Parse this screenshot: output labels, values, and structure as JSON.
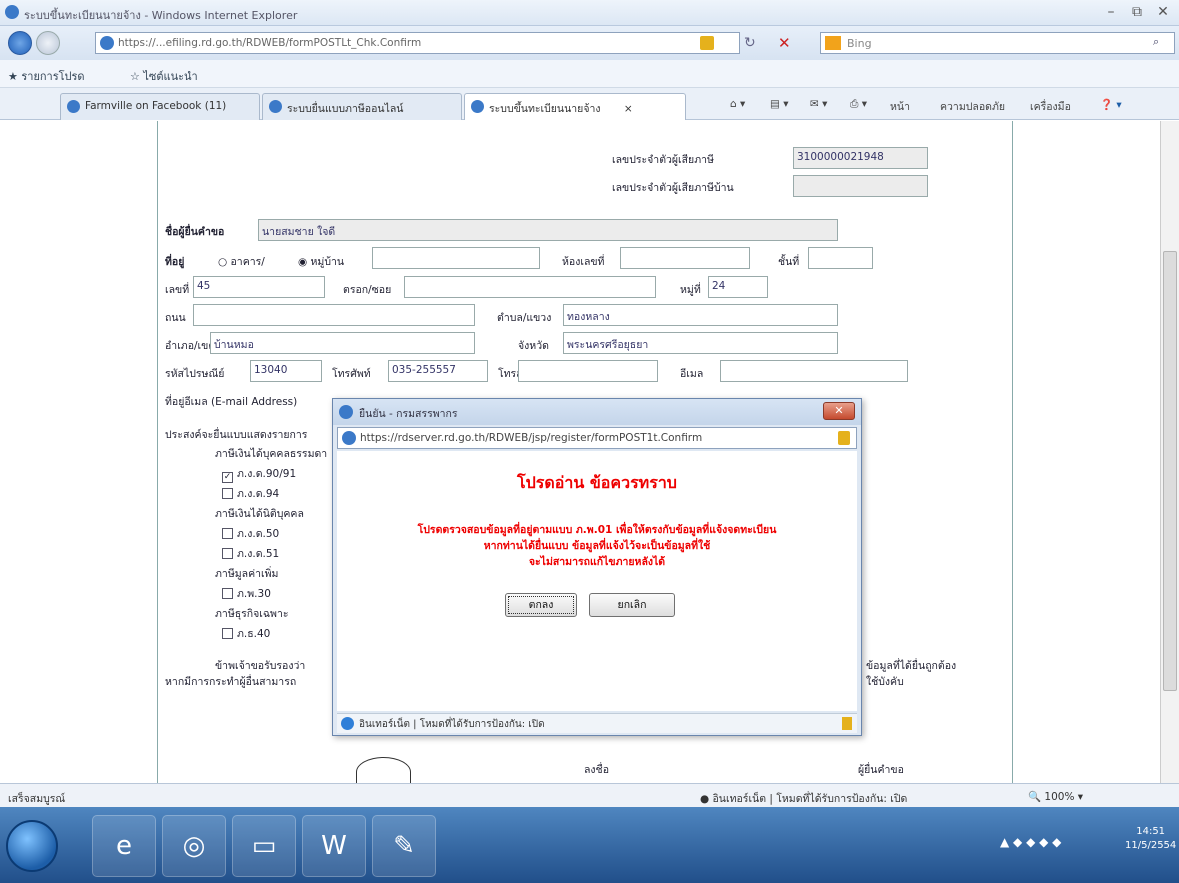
{
  "window": {
    "title": "ระบบขึ้นทะเบียนนายจ้าง - Windows Internet Explorer"
  },
  "address": {
    "url": "https://...efiling.rd.go.th/RDWEB/formPOSTLt_Chk.Confirm",
    "search_placeholder": "Bing"
  },
  "favorites": {
    "items": [
      "รายการโปรด",
      "ไซต์แนะนำ"
    ]
  },
  "tabs": [
    {
      "label": "Farmville on Facebook (11)"
    },
    {
      "label": "ระบบยื่นแบบภาษีออนไลน์"
    },
    {
      "label": "ระบบขึ้นทะเบียนนายจ้าง"
    }
  ],
  "commands": [
    "หน้า",
    "ความปลอดภัย",
    "เครื่องมือ"
  ],
  "form": {
    "taxid_label": "เลขประจำตัวผู้เสียภาษี",
    "taxid_value": "3100000021948",
    "branch_label": "เลขประจำตัวผู้เสียภาษีบ้าน",
    "name_label": "ชื่อผู้ยื่นคำขอ",
    "name_value": "นายสมชาย ใจดี",
    "address_label": "ที่อยู่",
    "building_opt": "อาคาร/",
    "village_opt": "หมู่บ้าน",
    "room_label": "ห้องเลขที่",
    "floor_label": "ชั้นที่",
    "house_label": "เลขที่",
    "house_value": "45",
    "soi_label": "ตรอก/ซอย",
    "moo_label": "หมู่ที่",
    "moo_value": "24",
    "road_label": "ถนน",
    "subdistrict_label": "ตำบล/แขวง",
    "subdistrict_value": "ทองหลาง",
    "district_label": "อำเภอ/เขต",
    "district_value": "บ้านหมอ",
    "province_label": "จังหวัด",
    "province_value": "พระนครศรีอยุธยา",
    "postcode_label": "รหัสไปรษณีย์",
    "postcode_value": "13040",
    "phone_label": "โทรศัพท์",
    "phone_value": "035-255557",
    "fax_label": "โทรสาร",
    "email_label": "อีเมล",
    "emailaddr_label": "ที่อยู่อีเมล (E-mail Address)",
    "section_label": "ประสงค์จะยื่นแบบแสดงรายการ",
    "group1": "ภาษีเงินได้บุคคลธรรมดา",
    "opt1": "ภ.ง.ด.90/91",
    "opt2": "ภ.ง.ด.94",
    "group2": "ภาษีเงินได้นิติบุคคล",
    "opt3": "ภ.ง.ด.50",
    "opt4": "ภ.ง.ด.51",
    "group3": "ภาษีมูลค่าเพิ่ม",
    "opt5": "ภ.พ.30",
    "group4": "ภาษีธุรกิจเฉพาะ",
    "opt6": "ภ.ธ.40",
    "footnote1": "ข้าพเจ้าขอรับรองว่า",
    "footnote2": "หากมีการกระทำผู้อื่นสามารถ",
    "footnote_right1": "ข้อมูลที่ได้ยื่นถูกต้อง",
    "footnote_right2": "ใช้บังคับ",
    "sign_label": "ลงชื่อ",
    "date_label": "ผู้ยื่นคำขอ"
  },
  "popup": {
    "title": "ยืนยัน - กรมสรรพากร",
    "url": "https://rdserver.rd.go.th/RDWEB/jsp/register/formPOST1t.Confirm",
    "heading": "โปรดอ่าน ข้อควรทราบ",
    "msg1": "โปรดตรวจสอบข้อมูลที่อยู่ตามแบบ ภ.พ.01 เพื่อให้ตรงกับข้อมูลที่แจ้งจดทะเบียน",
    "msg2": "หากท่านได้ยื่นแบบ ข้อมูลที่แจ้งไว้จะเป็นข้อมูลที่ใช้",
    "msg3": "จะไม่สามารถแก้ไขภายหลังได้",
    "btn_ok": "ตกลง",
    "btn_cancel": "ยกเลิก",
    "status": "อินเทอร์เน็ต | โหมดที่ได้รับการป้องกัน: เปิด"
  },
  "statusbar": {
    "left": "เสร็จสมบูรณ์",
    "zone": "อินเทอร์เน็ต | โหมดที่ได้รับการป้องกัน: เปิด",
    "zoom": "100%"
  },
  "taskbar": {
    "time": "14:51",
    "date": "11/5/2554"
  }
}
